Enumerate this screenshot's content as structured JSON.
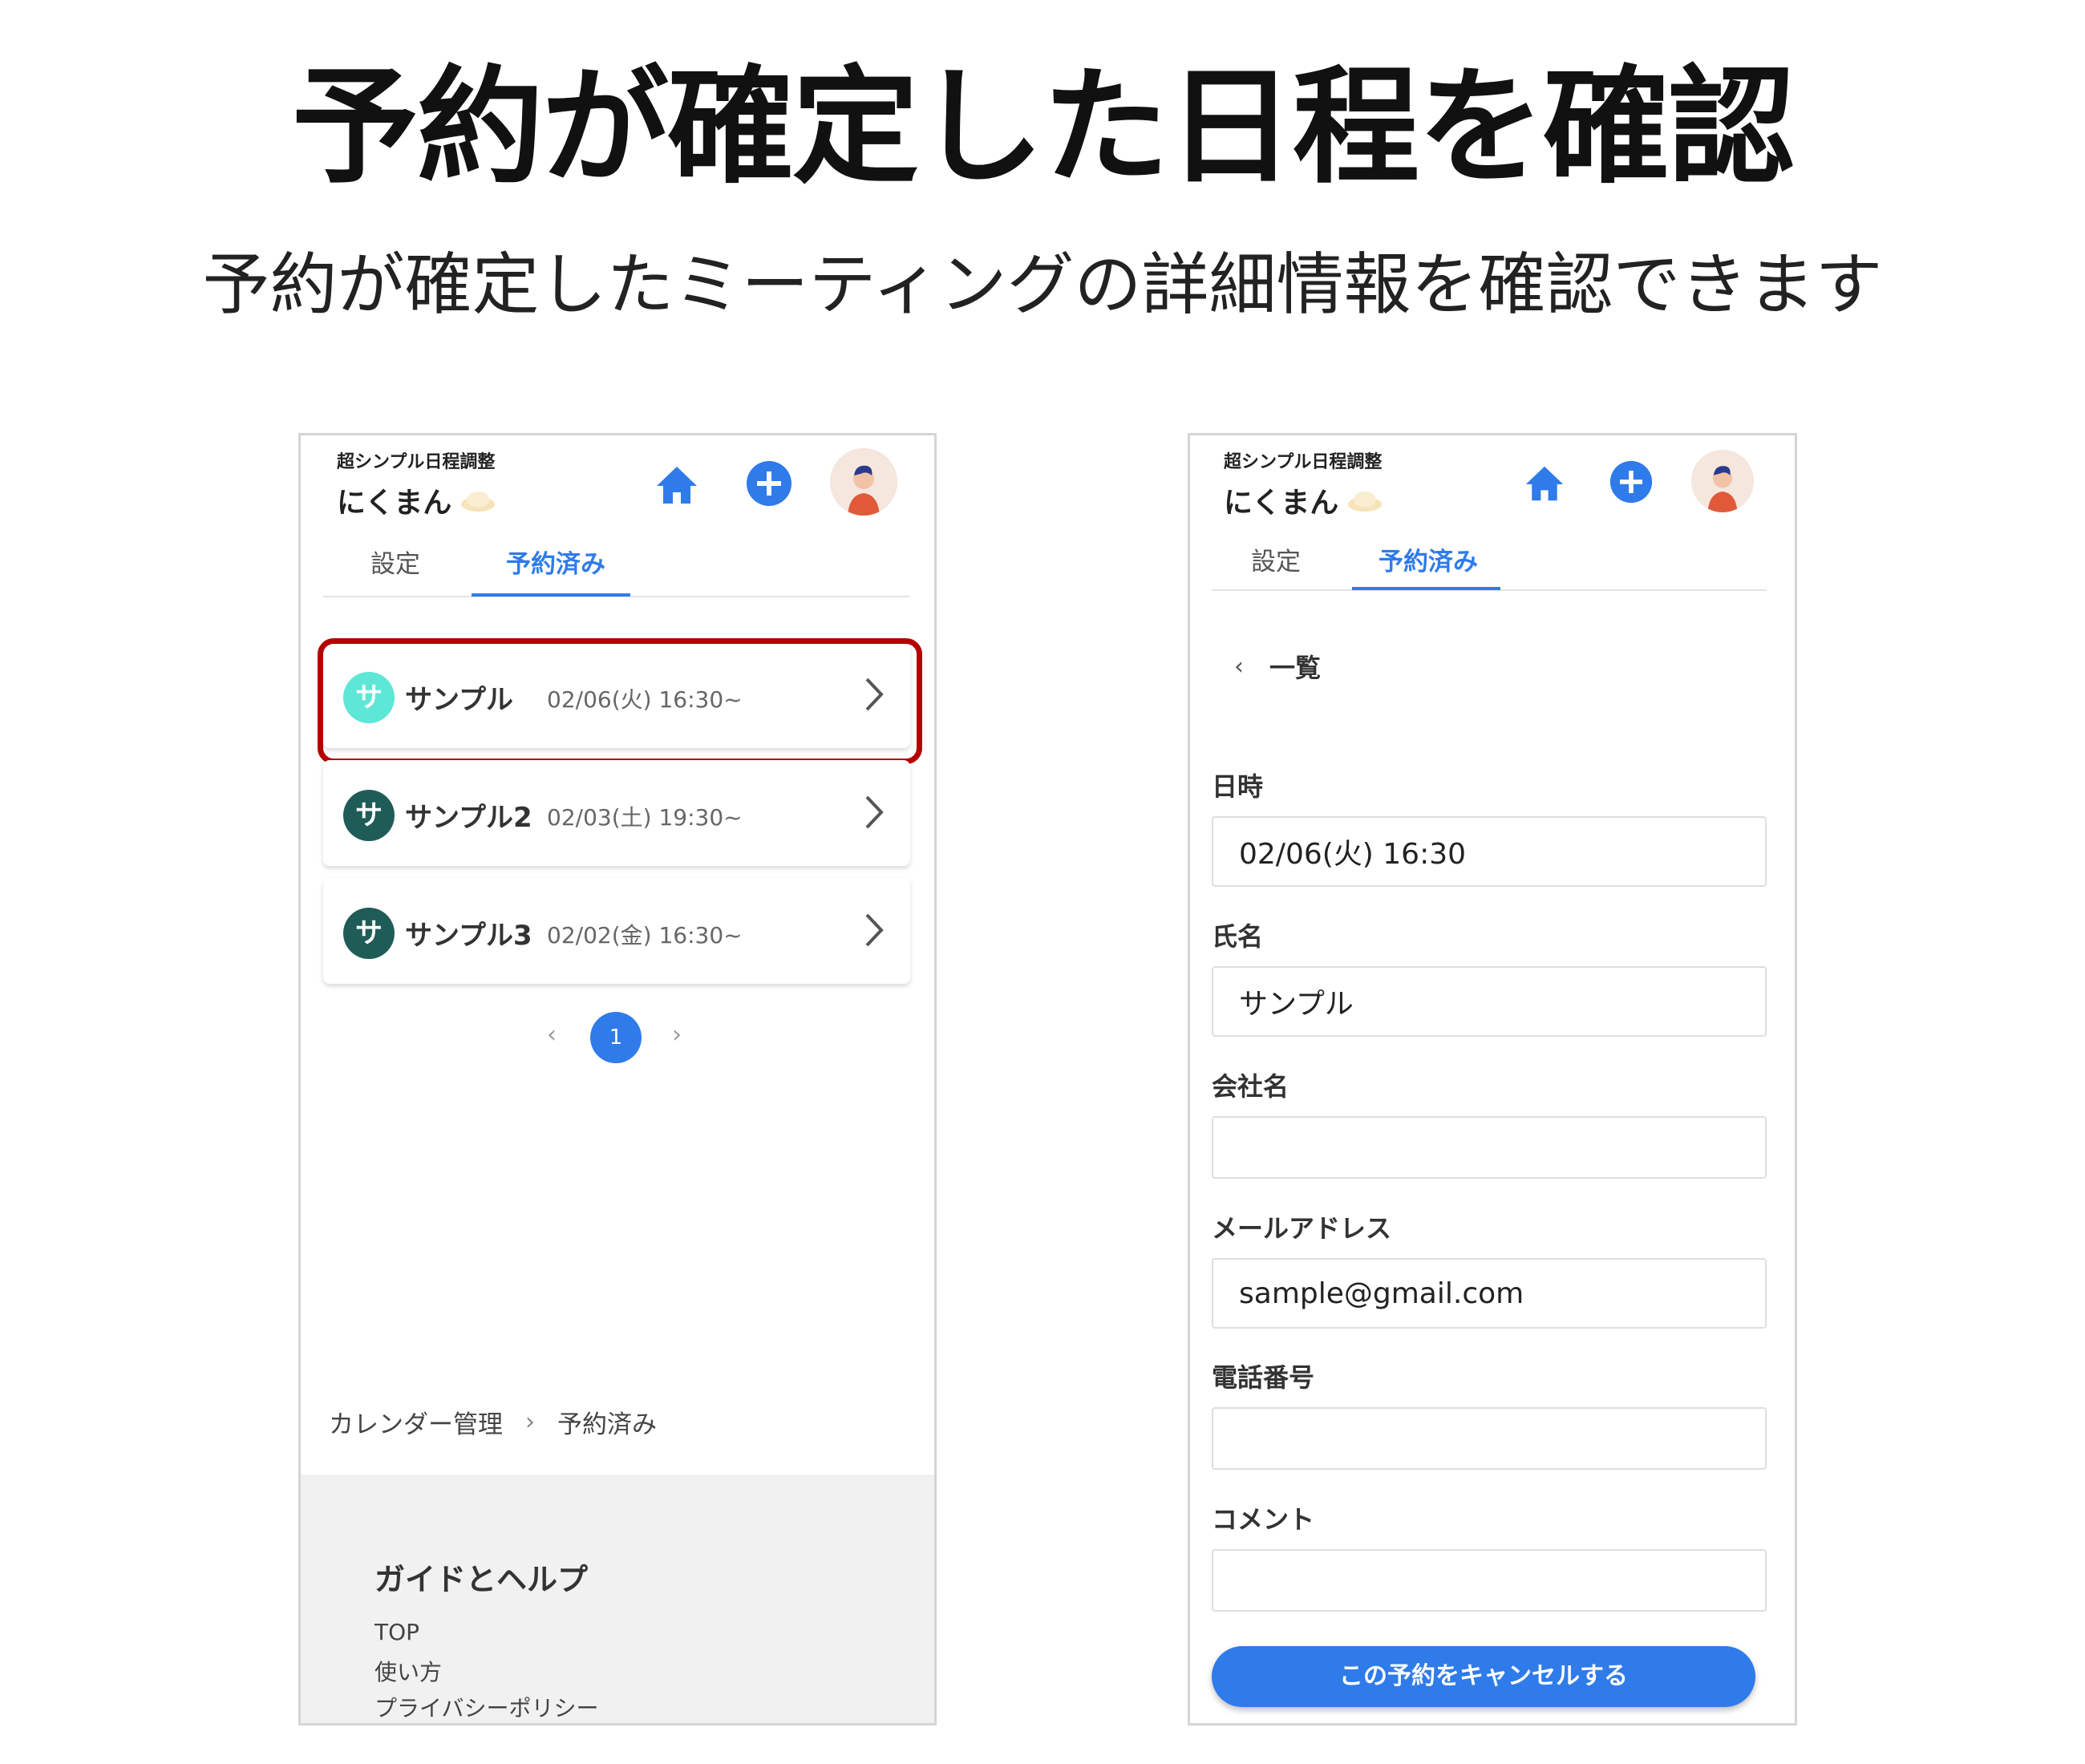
{
  "headline": "予約が確定した日程を確認",
  "subheadline": "予約が確定したミーティングの詳細情報を確認できます",
  "app": {
    "subtitle": "超シンプル日程調整",
    "name": "にくまん",
    "icons": {
      "home": "home-icon",
      "add": "plus-circle-icon",
      "avatar": "user-avatar"
    },
    "accent_color": "#2f7bea"
  },
  "tabs": [
    {
      "label": "設定",
      "active": false
    },
    {
      "label": "予約済み",
      "active": true
    }
  ],
  "reservations": [
    {
      "initial": "サ",
      "name": "サンプル",
      "datetime": "02/06(火) 16:30~",
      "color": "#5ee6d6",
      "highlighted": true
    },
    {
      "initial": "サ",
      "name": "サンプル2",
      "datetime": "02/03(土) 19:30~",
      "color": "#1f5c57",
      "highlighted": false
    },
    {
      "initial": "サ",
      "name": "サンプル3",
      "datetime": "02/02(金) 16:30~",
      "color": "#1f5c57",
      "highlighted": false
    }
  ],
  "highlight_color": "#b30000",
  "pagination": {
    "prev": "‹",
    "current": "1",
    "next": "›"
  },
  "breadcrumb": {
    "items": [
      "カレンダー管理",
      "予約済み"
    ],
    "separator": "›"
  },
  "footer": {
    "title": "ガイドとヘルプ",
    "links": [
      "TOP",
      "使い方",
      "プライバシーポリシー"
    ]
  },
  "detail": {
    "back_label": "一覧",
    "back_icon": "‹",
    "fields": [
      {
        "label": "日時",
        "value": "02/06(火) 16:30"
      },
      {
        "label": "氏名",
        "value": "サンプル"
      },
      {
        "label": "会社名",
        "value": ""
      },
      {
        "label": "メールアドレス",
        "value": "sample@gmail.com"
      },
      {
        "label": "電話番号",
        "value": ""
      },
      {
        "label": "コメント",
        "value": ""
      }
    ],
    "cancel_label": "この予約をキャンセルする"
  }
}
